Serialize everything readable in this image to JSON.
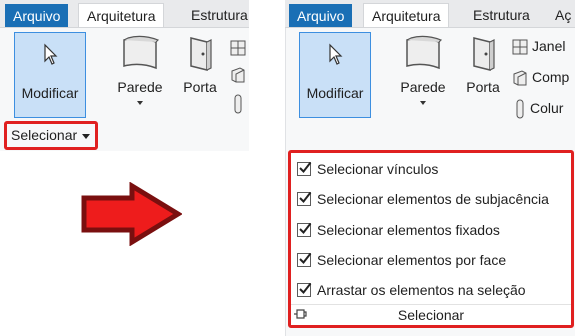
{
  "tabs": {
    "file": "Arquivo",
    "architecture": "Arquitetura",
    "structure": "Estrutura",
    "truncated_next": "Aç"
  },
  "tools": {
    "modify": "Modificar",
    "wall": "Parede",
    "door": "Porta",
    "window_truncated": "Janel",
    "component_truncated": "Comp",
    "column_truncated": "Colur"
  },
  "select_dropdown": {
    "label": "Selecionar"
  },
  "select_menu": {
    "items": [
      {
        "label": "Selecionar vínculos",
        "checked": true
      },
      {
        "label": "Selecionar elementos de subjacência",
        "checked": true
      },
      {
        "label": "Selecionar elementos fixados",
        "checked": true
      },
      {
        "label": "Selecionar elementos por face",
        "checked": true
      },
      {
        "label": "Arrastar os elementos na seleção",
        "checked": true
      }
    ],
    "footer": "Selecionar"
  },
  "colors": {
    "file_tab": "#1a6fb5",
    "highlight": "#e02020",
    "arrow_fill": "#ee1c1c",
    "arrow_outline": "#7a0f0f",
    "selected_button": "#c9e0f7"
  }
}
